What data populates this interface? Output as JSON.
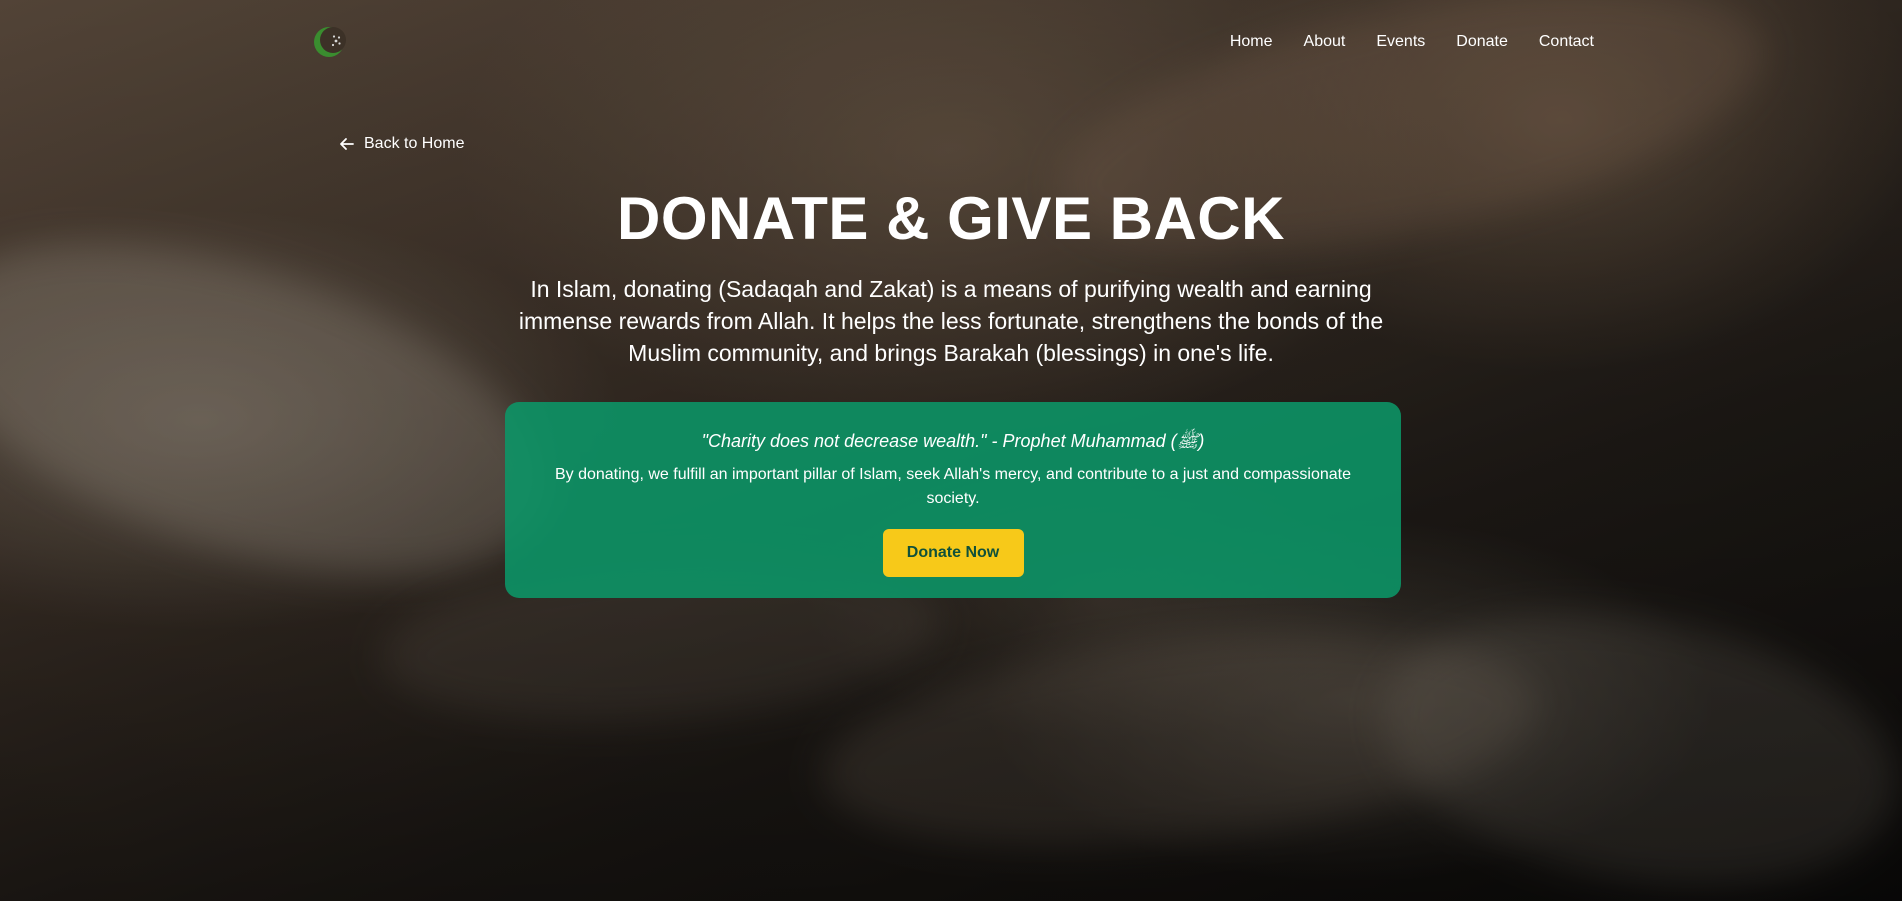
{
  "nav": {
    "logo_icon": "crescent-star-icon",
    "links": [
      {
        "label": "Home"
      },
      {
        "label": "About"
      },
      {
        "label": "Events"
      },
      {
        "label": "Donate"
      },
      {
        "label": "Contact"
      }
    ]
  },
  "back_link": {
    "icon": "arrow-left-icon",
    "label": "Back to Home"
  },
  "hero": {
    "title": "DONATE & GIVE BACK",
    "description": "In Islam, donating (Sadaqah and Zakat) is a means of purifying wealth and earning immense rewards from Allah. It helps the less fortunate, strengthens the bonds of the Muslim community, and brings Barakah (blessings) in one's life."
  },
  "card": {
    "quote": "\"Charity does not decrease wealth.\" - Prophet Muhammad (ﷺ)",
    "text": "By donating, we fulfill an important pillar of Islam, seek Allah's mercy, and contribute to a just and compassionate society.",
    "button_label": "Donate Now"
  },
  "colors": {
    "card_bg": "#0b9668",
    "button_bg": "#f7c919",
    "button_text": "#10513a",
    "logo_green": "#3a8d2f"
  }
}
